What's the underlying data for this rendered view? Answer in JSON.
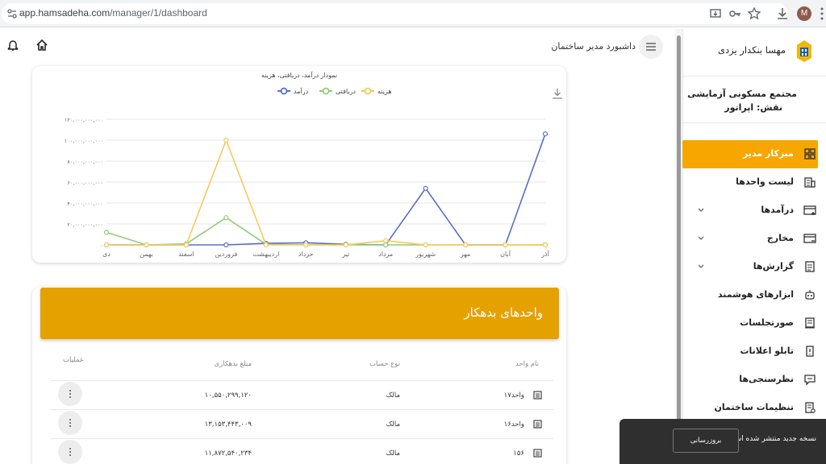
{
  "browser": {
    "url_host": "app.hamsadeha.com",
    "url_path": "/manager/1/dashboard",
    "avatar_letter": "M"
  },
  "header": {
    "title": "داشبورد مدیر ساختمان"
  },
  "sidebar": {
    "user_name": "مهسا بنکدار یزدی",
    "complex_name": "مجتمع مسکونی آزمایشی",
    "role": "نقش: اپراتور",
    "items": [
      {
        "label": "میزکار مدیر",
        "icon": "dashboard-icon",
        "active": true,
        "has_chevron": false
      },
      {
        "label": "لیست واحدها",
        "icon": "building-icon",
        "active": false,
        "has_chevron": false
      },
      {
        "label": "درآمدها",
        "icon": "card-add-icon",
        "active": false,
        "has_chevron": true
      },
      {
        "label": "مخارج",
        "icon": "card-minus-icon",
        "active": false,
        "has_chevron": true
      },
      {
        "label": "گزارش‌ها",
        "icon": "report-icon",
        "active": false,
        "has_chevron": true
      },
      {
        "label": "ابزارهای هوشمند",
        "icon": "robot-icon",
        "active": false,
        "has_chevron": false
      },
      {
        "label": "صورتجلسات",
        "icon": "minutes-icon",
        "active": false,
        "has_chevron": false
      },
      {
        "label": "تابلو اعلانات",
        "icon": "board-icon",
        "active": false,
        "has_chevron": false
      },
      {
        "label": "نظرسنجی‌ها",
        "icon": "poll-icon",
        "active": false,
        "has_chevron": false
      },
      {
        "label": "تنظیمات ساختمان",
        "icon": "settings-doc-icon",
        "active": false,
        "has_chevron": false
      }
    ]
  },
  "chart_data": {
    "type": "line",
    "title": "نمودار درآمد، دریافتی، هزینه",
    "categories": [
      "دی",
      "بهمن",
      "اسفند",
      "فروردین",
      "اردیبهشت",
      "خرداد",
      "تیر",
      "مرداد",
      "شهریور",
      "مهر",
      "آبان",
      "آذر"
    ],
    "y_ticks": [
      "۰",
      "۲۰,۰۰۰,۰۰۰,۰۰۰",
      "۴۰,۰۰۰,۰۰۰,۰۰۰",
      "۶۰,۰۰۰,۰۰۰,۰۰۰",
      "۸۰,۰۰۰,۰۰۰,۰۰۰",
      "۱۰۰,۰۰۰,۰۰۰,۰۰۰",
      "۱۲۰,۰۰۰,۰۰۰,۰۰۰"
    ],
    "ylim": [
      0,
      120000000000
    ],
    "grid": true,
    "legend_position": "top-center",
    "series": [
      {
        "name": "درآمد",
        "color": "#5470c6",
        "values": [
          0,
          0,
          0,
          0,
          1500000000,
          2000000000,
          500000000,
          0,
          54000000000,
          0,
          0,
          106000000000
        ]
      },
      {
        "name": "دریافتی",
        "color": "#91cc75",
        "values": [
          12000000000,
          0,
          1000000000,
          26000000000,
          500000000,
          0,
          0,
          0,
          0,
          0,
          0,
          0
        ]
      },
      {
        "name": "هزینه",
        "color": "#fac858",
        "values": [
          0,
          0,
          0,
          100000000000,
          0,
          0,
          0,
          4000000000,
          0,
          0,
          0,
          0
        ]
      }
    ]
  },
  "debtors": {
    "title": "واحدهای بدهکار",
    "columns": {
      "unit": "نام واحد",
      "account_type": "نوع حساب",
      "amount": "مبلغ بدهکاری",
      "ops": "عملیات"
    },
    "rows": [
      {
        "unit": "واحد۱۷",
        "account_type": "مالک",
        "amount": "۱۰,۵۵۰,۲۹۹,۱۲۰"
      },
      {
        "unit": "واحد۱۶",
        "account_type": "مالک",
        "amount": "۱۳,۱۵۳,۴۴۳,۰۰۹"
      },
      {
        "unit": "۱۵۶",
        "account_type": "مالک",
        "amount": "۱۱,۸۷۲,۵۴۰,۲۳۴"
      }
    ]
  },
  "toast": {
    "message": "نسخه جدید منتشر شده است.",
    "button": "بروزرسانی"
  }
}
